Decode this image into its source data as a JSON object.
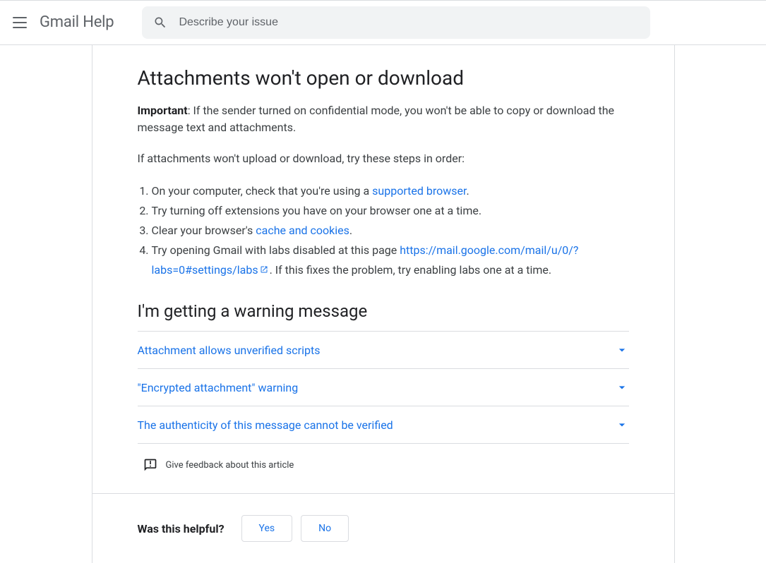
{
  "header": {
    "brand": "Gmail Help",
    "search_placeholder": "Describe your issue"
  },
  "section1": {
    "heading": "Attachments won't open or download",
    "important_label": "Important",
    "important_text": ": If the sender turned on confidential mode, you won't be able to copy or download the message text and attachments.",
    "intro": "If attachments won't upload or download, try these steps in order:",
    "step1_pre": "On your computer, check that you're using a ",
    "step1_link": "supported browser",
    "step1_post": ".",
    "step2": "Try turning off extensions you have on your browser one at a time.",
    "step3_pre": "Clear your browser's ",
    "step3_link": "cache and cookies",
    "step3_post": ".",
    "step4_pre": "Try opening Gmail with labs disabled at this page ",
    "step4_link": "https://mail.google.com/mail/u/0/?labs=0#settings/labs",
    "step4_post": ". If this fixes the problem, try enabling labs one at a time."
  },
  "section2": {
    "heading": "I'm getting a warning message",
    "items": [
      "Attachment allows unverified scripts",
      "\"Encrypted attachment\" warning",
      "The authenticity of this message cannot be verified"
    ]
  },
  "feedback": {
    "text": "Give feedback about this article"
  },
  "helpful": {
    "label": "Was this helpful?",
    "yes": "Yes",
    "no": "No"
  }
}
